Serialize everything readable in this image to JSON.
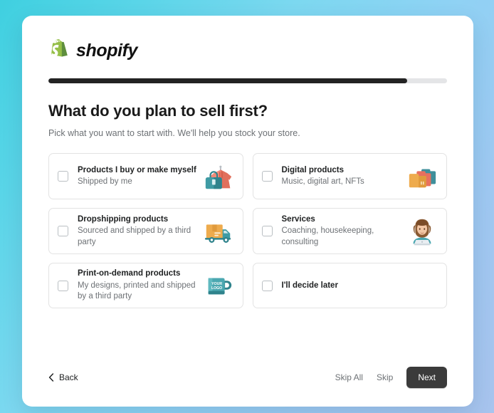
{
  "brand": {
    "logo_icon": "shopify-bag-icon",
    "wordmark": "shopify",
    "logo_green": "#95BF47",
    "logo_green_dark": "#5E8E3E"
  },
  "progress": {
    "percent": 90,
    "fill_color": "#232323",
    "track_color": "#e4e5e7"
  },
  "header": {
    "title": "What do you plan to sell first?",
    "subtitle": "Pick what you want to start with. We'll help you stock your store."
  },
  "options": [
    {
      "title": "Products I buy or make myself",
      "description": "Shipped by me",
      "checked": false,
      "icon": "bag-and-sweater-icon"
    },
    {
      "title": "Digital products",
      "description": "Music, digital art, NFTs",
      "checked": false,
      "icon": "folder-stack-icon"
    },
    {
      "title": "Dropshipping products",
      "description": "Sourced and shipped by a third party",
      "checked": false,
      "icon": "delivery-truck-icon"
    },
    {
      "title": "Services",
      "description": "Coaching, housekeeping, consulting",
      "checked": false,
      "icon": "person-laptop-icon"
    },
    {
      "title": "Print-on-demand products",
      "description": "My designs, printed and shipped by a third party",
      "checked": false,
      "icon": "logo-mug-icon",
      "mug_text_line1": "YOUR",
      "mug_text_line2": "LOGO"
    },
    {
      "title": "I'll decide later",
      "description": "",
      "checked": false,
      "icon": ""
    }
  ],
  "footer": {
    "back_label": "Back",
    "back_icon": "chevron-left-icon",
    "skip_all_label": "Skip All",
    "skip_label": "Skip",
    "next_label": "Next",
    "next_bg": "#3b3b3b"
  }
}
